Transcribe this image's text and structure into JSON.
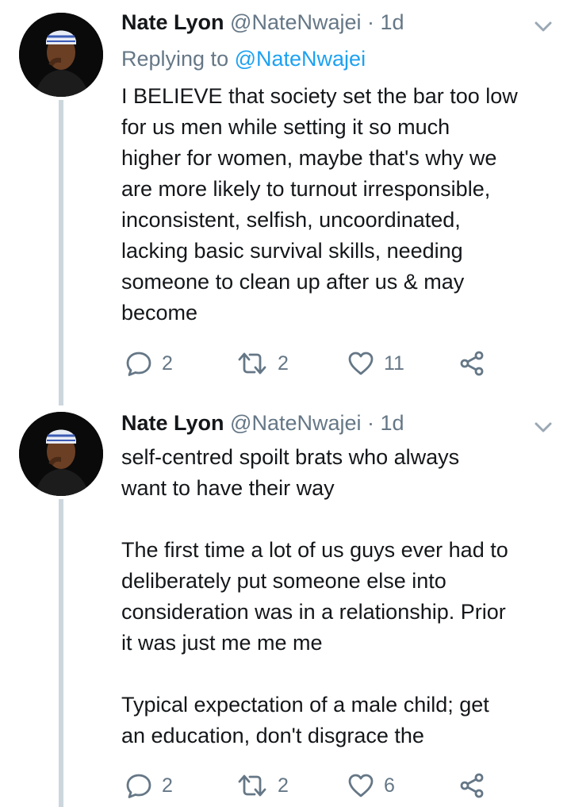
{
  "colors": {
    "text": "#14171a",
    "secondary": "#657786",
    "link": "#1da1f2",
    "thread_line": "#ccd6dd"
  },
  "tweets": [
    {
      "name": "Nate Lyon",
      "handle": "@NateNwajei",
      "dot": "·",
      "time": "1d",
      "replying_prefix": "Replying to ",
      "replying_handle": "@NateNwajei",
      "text": "I BELIEVE that society set the bar too low\nfor us men while setting it so much\nhigher for women, maybe that's why we\nare more likely to turnout irresponsible,\ninconsistent, selfish, uncoordinated,\nlacking basic survival skills, needing\nsomeone to clean up after us & may\nbecome",
      "replies": "2",
      "retweets": "2",
      "likes": "11",
      "icons": [
        "reply-icon",
        "retweet-icon",
        "like-icon",
        "share-icon",
        "chevron-down-icon"
      ]
    },
    {
      "name": "Nate Lyon",
      "handle": "@NateNwajei",
      "dot": "·",
      "time": "1d",
      "text": "self-centred spoilt brats who always\nwant to have their way\n\nThe first time a lot of us guys ever had to\ndeliberately put someone else into\nconsideration was in a relationship. Prior\nit was just me me me\n\nTypical expectation of a male child; get\nan education, don't disgrace the",
      "replies": "2",
      "retweets": "2",
      "likes": "6",
      "icons": [
        "reply-icon",
        "retweet-icon",
        "like-icon",
        "share-icon",
        "chevron-down-icon"
      ]
    }
  ]
}
